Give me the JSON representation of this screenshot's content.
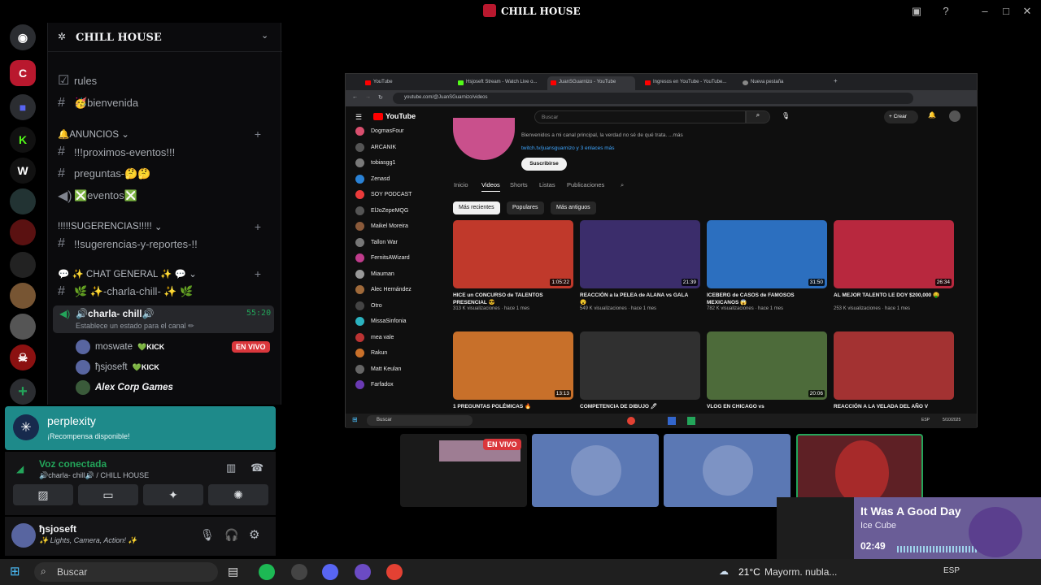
{
  "window": {
    "title": "CHILL HOUSE"
  },
  "server": {
    "name": "CHILL HOUSE",
    "channels": [
      {
        "name": "rules"
      },
      {
        "name": "🥳bienvenida"
      }
    ],
    "categories": {
      "anuncios": "🔔ANUNCIOS",
      "sugerencias": "!!!!!SUGERENCIAS!!!!!",
      "chat": "💬 ✨ CHAT GENERAL ✨ 💬"
    },
    "anuncios_channels": [
      "!!!proximos-eventos!!!",
      "preguntas-🤔🤔",
      "❎eventos❎"
    ],
    "sugerencias_channels": [
      "!!sugerencias-y-reportes-!!"
    ],
    "chat_channels": [
      "🌿 ✨-charla-chill- ✨ 🌿"
    ],
    "voice_channel": {
      "name": "🔊charla- chill🔊",
      "timer": "55:20",
      "status": "Establece un estado para el canal ✏"
    },
    "voice_users": [
      {
        "name": "moswate",
        "tag": "💚KICK",
        "live": "EN VIVO"
      },
      {
        "name": "ђsjoseft",
        "tag": "💚KICK"
      },
      {
        "name": "Alex Corp Games"
      }
    ]
  },
  "banner": {
    "title": "perplexity",
    "subtitle": "¡Recompensa disponible!"
  },
  "voice": {
    "status": "Voz conectada",
    "location": "🔊charla- chill🔊 / CHILL HOUSE"
  },
  "user": {
    "name": "ђsjoseft",
    "status": "✨ Lights, Camera, Action! ✨"
  },
  "browser": {
    "tabs": [
      "YouTube",
      "Hsjoseft Stream - Watch Live o...",
      "JuanSGuarnizo - YouTube",
      "Ingresos en YouTube - YouTube...",
      "Nueva pestaña"
    ],
    "url": "youtube.com/@JuanSGuarnizo/videos",
    "search_placeholder": "Buscar",
    "create_label": "+ Crear",
    "about": "Bienvenidos a mi canal principal, la verdad no sé de qué trata. ...más",
    "links": "twitch.tv/juansguarnizo y 3 enlaces más",
    "subscribe": "Suscribirse",
    "channel_tabs": [
      "Inicio",
      "Videos",
      "Shorts",
      "Listas",
      "Publicaciones"
    ],
    "chips": [
      "Más recientes",
      "Populares",
      "Más antiguos"
    ],
    "subs": [
      "DogmasFour",
      "ARCANIK",
      "tobiasgg1",
      "Zenasd",
      "SOY PODCAST",
      "ElJoZepeMQG",
      "Maikel Moreira",
      "Tallon War",
      "FernitsAWizard",
      "Miauman",
      "Alec Hernández",
      "Otro",
      "MissaSinfonia",
      "mea vale",
      "Rakun",
      "Matt Keulan",
      "Farfadox"
    ],
    "videos": [
      {
        "title": "HICE un CONCURSO de TALENTOS PRESENCIAL 😎",
        "meta": "313 K visualizaciones · hace 1 mes",
        "dur": "1:05:22",
        "color": "#c0392b"
      },
      {
        "title": "REACCIÓN a la PELEA de ALANA vs GALA 😮",
        "meta": "549 K visualizaciones · hace 1 mes",
        "dur": "21:39",
        "color": "#3b2d6b"
      },
      {
        "title": "ICEBERG de CASOS de FAMOSOS MEXICANOS 😱",
        "meta": "782 K visualizaciones · hace 1 mes",
        "dur": "31:50",
        "color": "#2c6fbf"
      },
      {
        "title": "AL MEJOR TALENTO LE DOY $200,000 🤑",
        "meta": "253 K visualizaciones · hace 1 mes",
        "dur": "26:34",
        "color": "#b8283e"
      },
      {
        "title": "1 PREGUNTAS POLÉMICAS 🔥",
        "meta": "",
        "dur": "13:13",
        "color": "#c8702a"
      },
      {
        "title": "COMPETENCIA DE DIBUJO 🖊",
        "meta": "",
        "dur": "",
        "color": "#303030"
      },
      {
        "title": "VLOG EN CHICAGO vs",
        "meta": "",
        "dur": "20:06",
        "color": "#4d6b3a"
      },
      {
        "title": "REACCIÓN A LA VELADA DEL AÑO V",
        "meta": "",
        "dur": "",
        "color": "#a33232"
      }
    ],
    "inner_search": "Buscar",
    "inner_lang": "ESP",
    "inner_date": "5/10/2025"
  },
  "previews": {
    "live_badge": "EN VIVO"
  },
  "music": {
    "song": "It Was A Good Day",
    "artist": "Ice Cube",
    "time": "02:49"
  },
  "taskbar": {
    "search": "Buscar",
    "weather": "21°C",
    "weather_text": "Mayorm. nubla...",
    "lang": "ESP"
  }
}
